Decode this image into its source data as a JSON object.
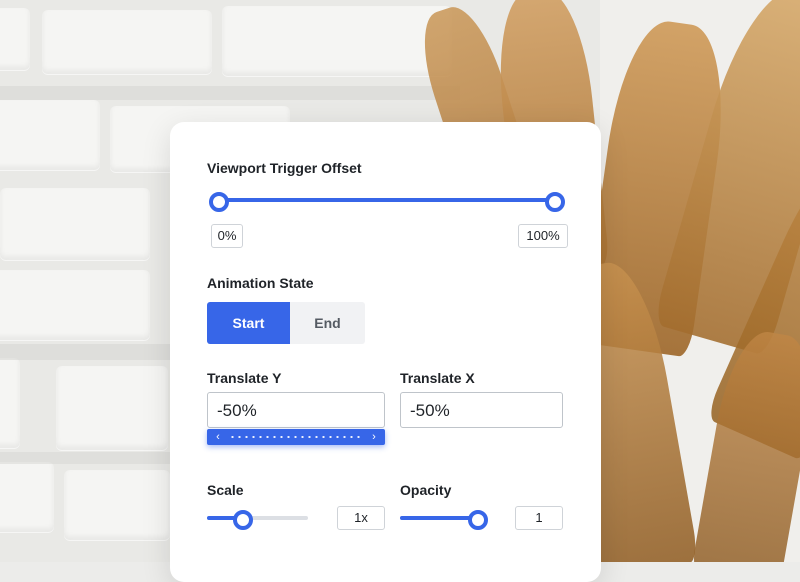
{
  "panel": {
    "viewport_offset": {
      "label": "Viewport Trigger Offset",
      "min_value": "0%",
      "max_value": "100%",
      "range_start": 0,
      "range_end": 100
    },
    "animation_state": {
      "label": "Animation State",
      "options": [
        "Start",
        "End"
      ],
      "selected": "Start"
    },
    "translate_y": {
      "label": "Translate Y",
      "value": "-50%"
    },
    "translate_x": {
      "label": "Translate X",
      "value": "-50%"
    },
    "scrubber": {
      "left_arrow": "‹",
      "right_arrow": "›"
    },
    "scale": {
      "label": "Scale",
      "value": "1x",
      "level": 0.36
    },
    "opacity": {
      "label": "Opacity",
      "value": "1",
      "level": 1.0
    }
  },
  "colors": {
    "accent": "#3766e8",
    "inactive_button": "#f1f2f4",
    "card_bg": "#ffffff"
  }
}
